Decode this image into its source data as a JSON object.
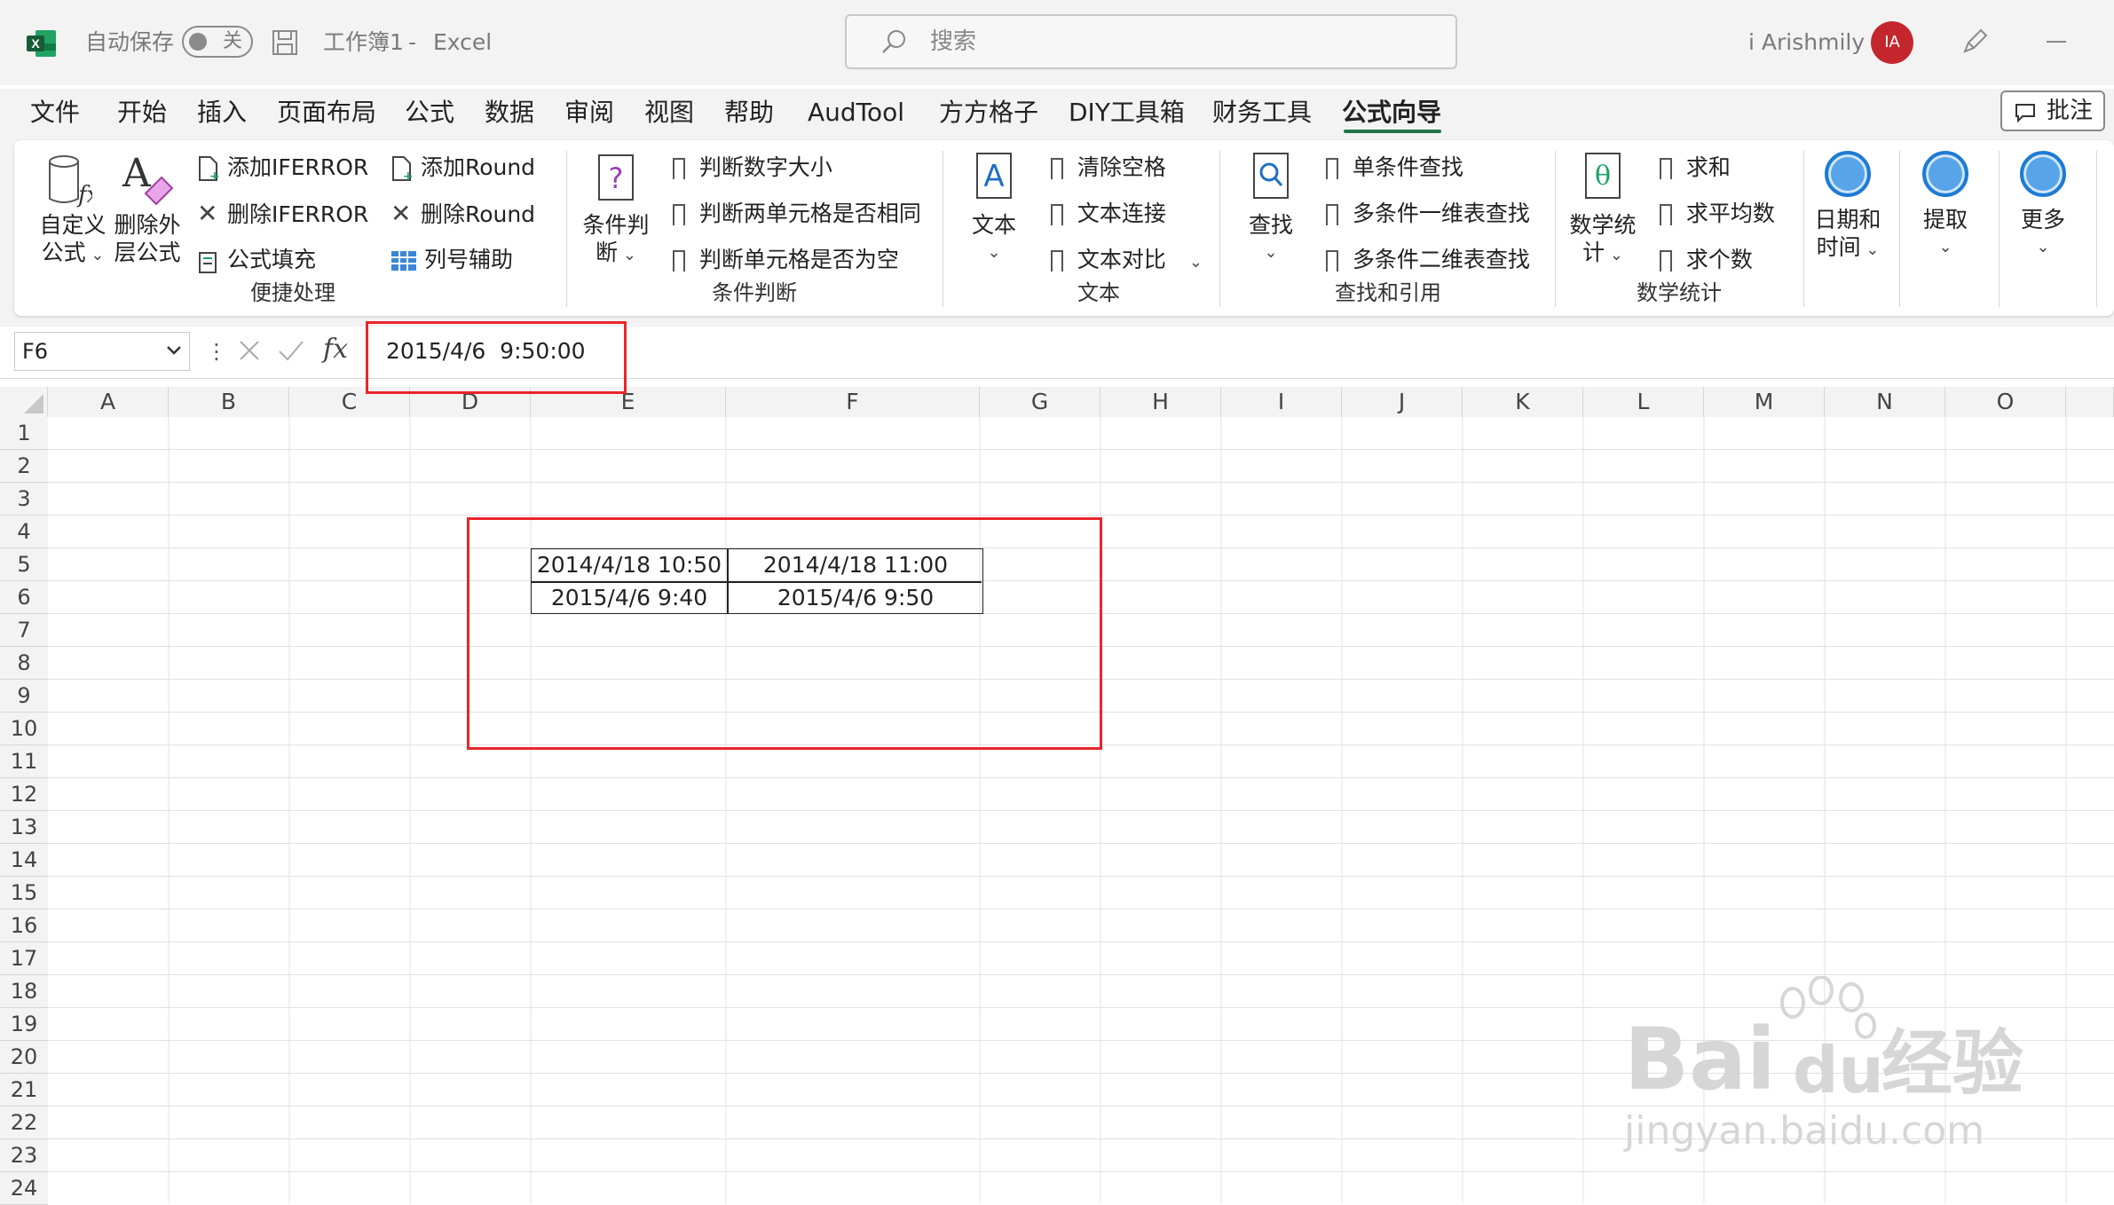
{
  "titlebar": {
    "autosave_label": "自动保存",
    "autosave_state": "关",
    "workbook": "工作簿1",
    "separator": "-",
    "app": "Excel",
    "search_placeholder": "搜索",
    "user_name": "i Arishmily",
    "avatar_initials": "IA"
  },
  "menu": {
    "tabs": [
      "文件",
      "开始",
      "插入",
      "页面布局",
      "公式",
      "数据",
      "审阅",
      "视图",
      "帮助",
      "AudTool",
      "方方格子",
      "DIY工具箱",
      "财务工具",
      "公式向导"
    ],
    "active_tab": "公式向导",
    "comment_button": "批注"
  },
  "ribbon": {
    "groups": [
      {
        "label": "便捷处理",
        "big": [
          {
            "label1": "自定义",
            "label2": "公式",
            "icon": "custom-formula-icon"
          },
          {
            "label1": "删除外",
            "label2": "层公式",
            "icon": "delete-outer-formula-icon"
          }
        ],
        "items": [
          "添加IFERROR",
          "删除IFERROR",
          "公式填充",
          "添加Round",
          "删除Round",
          "列号辅助"
        ]
      },
      {
        "label": "条件判断",
        "big": [
          {
            "label1": "条件判",
            "label2": "断",
            "icon": "condition-icon"
          }
        ],
        "items": [
          "判断数字大小",
          "判断两单元格是否相同",
          "判断单元格是否为空"
        ]
      },
      {
        "label": "文本",
        "big": [
          {
            "label1": "文本",
            "label2": "",
            "icon": "text-icon"
          }
        ],
        "items": [
          "清除空格",
          "文本连接",
          "文本对比"
        ]
      },
      {
        "label": "查找和引用",
        "big": [
          {
            "label1": "查找",
            "label2": "",
            "icon": "lookup-icon"
          }
        ],
        "items": [
          "单条件查找",
          "多条件一维表查找",
          "多条件二维表查找"
        ]
      },
      {
        "label": "数学统计",
        "big": [
          {
            "label1": "数学统",
            "label2": "计",
            "icon": "math-icon"
          }
        ],
        "items": [
          "求和",
          "求平均数",
          "求个数"
        ]
      }
    ],
    "extra_buttons": [
      {
        "label1": "日期和",
        "label2": "时间"
      },
      {
        "label1": "提取",
        "label2": ""
      },
      {
        "label1": "更多",
        "label2": ""
      }
    ]
  },
  "formula_bar": {
    "name_box": "F6",
    "fx_label": "fx",
    "value": "2015/4/6  9:50:00"
  },
  "grid": {
    "columns": [
      "A",
      "B",
      "C",
      "D",
      "E",
      "F",
      "G",
      "H",
      "I",
      "J",
      "K",
      "L",
      "M",
      "N",
      "O"
    ],
    "rows": [
      "1",
      "2",
      "3",
      "4",
      "5",
      "6",
      "7",
      "8",
      "9",
      "10",
      "11",
      "12",
      "13",
      "14",
      "15",
      "16",
      "17",
      "18",
      "19",
      "20",
      "21",
      "22",
      "23",
      "24"
    ],
    "cells": [
      [
        "2014/4/18 10:50",
        "2014/4/18 11:00"
      ],
      [
        "2015/4/6 9:40",
        "2015/4/6 9:50"
      ]
    ]
  },
  "watermark": {
    "brand": "Bai",
    "brand2": "du",
    "cn": "经验",
    "url": "jingyan.baidu.com"
  },
  "colors": {
    "accent": "#217346",
    "highlight": "#e8262c",
    "avatar": "#c4262e"
  }
}
